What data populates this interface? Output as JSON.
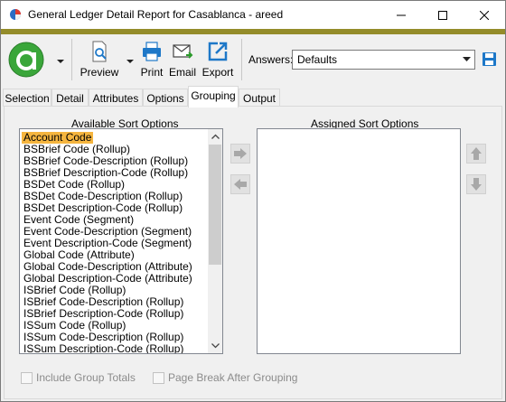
{
  "window": {
    "title": "General Ledger Detail Report for Casablanca - areed"
  },
  "toolbar": {
    "preview_label": "Preview",
    "print_label": "Print",
    "email_label": "Email",
    "export_label": "Export",
    "answers_label": "Answers:",
    "answers_value": "Defaults"
  },
  "tabs": [
    "Selection",
    "Detail",
    "Attributes",
    "Options",
    "Grouping",
    "Output"
  ],
  "active_tab": "Grouping",
  "grouping": {
    "available_label": "Available Sort Options",
    "assigned_label": "Assigned Sort Options",
    "available_items": [
      "Account Code",
      "BSBrief Code (Rollup)",
      "BSBrief Code-Description (Rollup)",
      "BSBrief Description-Code (Rollup)",
      "BSDet Code (Rollup)",
      "BSDet Code-Description (Rollup)",
      "BSDet Description-Code (Rollup)",
      "Event Code (Segment)",
      "Event Code-Description (Segment)",
      "Event Description-Code (Segment)",
      "Global Code (Attribute)",
      "Global Code-Description (Attribute)",
      "Global Description-Code (Attribute)",
      "ISBrief Code (Rollup)",
      "ISBrief Code-Description (Rollup)",
      "ISBrief Description-Code (Rollup)",
      "ISSum Code (Rollup)",
      "ISSum Code-Description (Rollup)",
      "ISSum Description-Code (Rollup)"
    ],
    "selected_item": "Account Code",
    "assigned_items": [],
    "include_group_totals_label": "Include Group Totals",
    "page_break_label": "Page Break After Grouping"
  },
  "colors": {
    "accent_bar": "#948c2a",
    "logo_green": "#3aa63a",
    "selection": "#f5b53f",
    "icon_blue": "#1e78c8"
  }
}
